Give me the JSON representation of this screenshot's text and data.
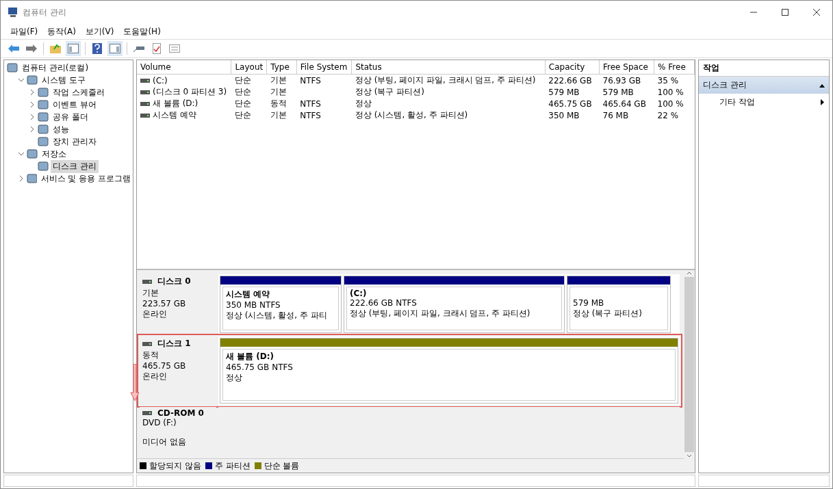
{
  "window": {
    "title": "컴퓨터 관리"
  },
  "menu": [
    "파일(F)",
    "동작(A)",
    "보기(V)",
    "도움말(H)"
  ],
  "tree": [
    {
      "label": "컴퓨터 관리(로컬)",
      "selected": false,
      "children": [
        {
          "label": "시스템 도구",
          "expanded": true,
          "selected": false,
          "children": [
            {
              "label": "작업 스케줄러",
              "expanded": false,
              "selected": false
            },
            {
              "label": "이벤트 뷰어",
              "expanded": false,
              "selected": false
            },
            {
              "label": "공유 폴더",
              "expanded": false,
              "selected": false
            },
            {
              "label": "성능",
              "expanded": false,
              "selected": false
            },
            {
              "label": "장치 관리자",
              "selected": false
            }
          ]
        },
        {
          "label": "저장소",
          "expanded": true,
          "selected": false,
          "children": [
            {
              "label": "디스크 관리",
              "selected": true
            }
          ]
        },
        {
          "label": "서비스 및 응용 프로그램",
          "expanded": false,
          "selected": false
        }
      ]
    }
  ],
  "volume_table": {
    "columns": [
      "Volume",
      "Layout",
      "Type",
      "File System",
      "Status",
      "Capacity",
      "Free Space",
      "% Free"
    ],
    "rows": [
      [
        "(C:)",
        "단순",
        "기본",
        "NTFS",
        "정상 (부팅, 페이지 파일, 크래시 덤프, 주 파티션)",
        "222.66 GB",
        "76.93 GB",
        "35 %"
      ],
      [
        "(디스크 0 파티션 3)",
        "단순",
        "기본",
        "",
        "정상 (복구 파티션)",
        "579 MB",
        "579 MB",
        "100 %"
      ],
      [
        "새 볼륨 (D:)",
        "단순",
        "동적",
        "NTFS",
        "정상",
        "465.75 GB",
        "465.64 GB",
        "100 %"
      ],
      [
        "시스템 예약",
        "단순",
        "기본",
        "NTFS",
        "정상 (시스템, 활성, 주 파티션)",
        "350 MB",
        "76 MB",
        "22 %"
      ]
    ]
  },
  "disks": [
    {
      "name": "디스크 0",
      "type": "기본",
      "size": "223.57 GB",
      "status": "온라인",
      "highlighted": false,
      "partitions": [
        {
          "name": "시스템 예약",
          "detail": "350 MB NTFS",
          "status": "정상 (시스템, 활성, 주 파티",
          "color": "#000080"
        },
        {
          "name": "(C:)",
          "detail": "222.66 GB NTFS",
          "status": "정상 (부팅, 페이지 파일, 크래시 덤프, 주 파티션)",
          "color": "#000080"
        },
        {
          "detail": "579 MB",
          "status": "정상 (복구 파티션)",
          "color": "#000080"
        }
      ]
    },
    {
      "name": "디스크 1",
      "type": "동적",
      "size": "465.75 GB",
      "status": "온라인",
      "highlighted": true,
      "partitions": [
        {
          "name": "새 볼륨  (D:)",
          "detail": "465.75 GB NTFS",
          "status": "정상",
          "color": "#808000"
        }
      ]
    },
    {
      "name": "CD-ROM 0",
      "type": "DVD (F:)",
      "status": "미디어 없음",
      "highlighted": false
    }
  ],
  "legend": [
    {
      "label": "할당되지 않음",
      "color": "#000000"
    },
    {
      "label": "주 파티션",
      "color": "#000080"
    },
    {
      "label": "단순 볼륨",
      "color": "#808000"
    }
  ],
  "actions": {
    "title": "작업",
    "section": "디스크 관리",
    "items": [
      "기타 작업"
    ]
  }
}
